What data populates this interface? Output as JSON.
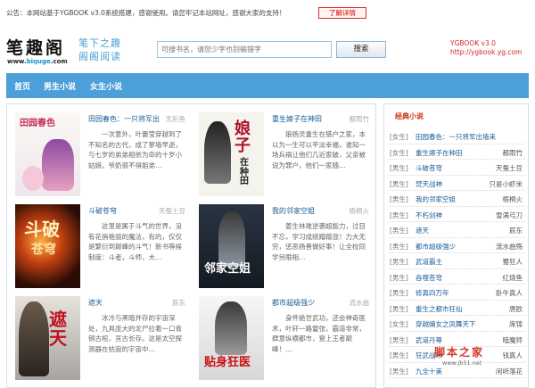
{
  "notice": {
    "text": "公告：本网站基于YGBOOK v3.0系统搭建，感谢使用。请您牢记本站网址，感谢大家的支持！",
    "button": "了解详情"
  },
  "header": {
    "logo_text": "笔趣阁",
    "logo_url_prefix": "www.",
    "logo_url_brand": "biquge",
    "logo_url_suffix": ".com",
    "slogan_line1": "笔下之趣",
    "slogan_line2": "阁阁阅读",
    "search_placeholder": "可搜书名，请您少字也别输错字",
    "search_button": "搜索",
    "site_name": "YGBOOK v3.0",
    "site_url": "http://ygbook.yg.com"
  },
  "nav": {
    "items": [
      "首页",
      "男生小说",
      "女生小说"
    ]
  },
  "books": [
    {
      "title": "田园春色：一只将军出",
      "author": "无彩鱼",
      "desc": "一次意外，叶蕾莹穿越到了不知名的古代，成了寥墙早逝，与七岁的弟弟相依为命的十岁小姑娘。爷奶很不得姐弟…",
      "cover_title": "田园春色一只将军出墙来",
      "cover_colors": [
        "#f4f0ea",
        "#d84b6a",
        "#6a3a8a"
      ]
    },
    {
      "title": "重生嫁子在神田",
      "author": "都雨竹",
      "desc": "狼扬灵重生在猎户之家，本以为一生可以平淡幸福，谁知一场兵祸让他们几近家破，父亲被说为罪户，他们一家随…",
      "cover_title": "娘子在种田",
      "cover_colors": [
        "#f3f1ec",
        "#b0102a",
        "#333333"
      ]
    },
    {
      "title": "斗破苍穹",
      "author": "天蚕土豆",
      "desc": "这里是属于斗气的世界，没有花俏艳丽的魔法，有的，仅仅是繁衍到巅峰的斗气！新书等候制度：斗者，斗师，大…",
      "cover_title": "斗破苍穹",
      "cover_colors": [
        "#3a1a10",
        "#e06a20",
        "#ffd070"
      ]
    },
    {
      "title": "我的邻家空姐",
      "author": "梧桐火",
      "desc": "姜生林难逆袭超能力，过目不忘，学习成绩蹭蹭涨！力大无穷，惩恶扬善做好事！让全校同学另眼相…",
      "cover_title": "我的邻家空姐",
      "cover_colors": [
        "#1a2230",
        "#ffffff",
        "#6a7a8a"
      ]
    },
    {
      "title": "遮天",
      "author": "辰东",
      "desc": "冰冷与黑暗并存的宇宙深处，九具庞大的龙尸拉着一口青铜古棺，亘古长存。这是太空探测器在枯寂的宇宙中…",
      "cover_title": "遮天",
      "cover_colors": [
        "#e8e4de",
        "#c01020",
        "#555555"
      ]
    },
    {
      "title": "都市超级强少",
      "author": "流水曲",
      "desc": "身怀绝世武功，还会神奇医术，叶轩一路雷张，霸道非常，肆意纵横都市，登上王者巅峰！…",
      "cover_title": "贴身狂医",
      "cover_colors": [
        "#f2f2f2",
        "#c81010",
        "#444444"
      ]
    }
  ],
  "sidebar": {
    "title": "经典小说",
    "items": [
      {
        "cat": "[女生]",
        "name": "田园春色：一只将军出墙来",
        "author": ""
      },
      {
        "cat": "[女生]",
        "name": "重生嫁子在种田",
        "author": "都雨竹"
      },
      {
        "cat": "[男生]",
        "name": "斗破苍穹",
        "author": "天蚕土豆"
      },
      {
        "cat": "[男生]",
        "name": "焚天战神",
        "author": "只是小虾米"
      },
      {
        "cat": "[男生]",
        "name": "我的邻家空姐",
        "author": "梧桐火"
      },
      {
        "cat": "[男生]",
        "name": "不朽剑神",
        "author": "雪满弓刀"
      },
      {
        "cat": "[男生]",
        "name": "遮天",
        "author": "辰东"
      },
      {
        "cat": "[男生]",
        "name": "都市超级强少",
        "author": "流水曲殇"
      },
      {
        "cat": "[男生]",
        "name": "武道霸主",
        "author": "蜀狂人"
      },
      {
        "cat": "[男生]",
        "name": "吞噬苍穹",
        "author": "红烧鱼"
      },
      {
        "cat": "[男生]",
        "name": "修真四万年",
        "author": "卧牛真人"
      },
      {
        "cat": "[男生]",
        "name": "重生之都市狂仙",
        "author": "唐欧"
      },
      {
        "cat": "[女生]",
        "name": "穿越嫡女之凤舞天下",
        "author": "席锦"
      },
      {
        "cat": "[男生]",
        "name": "武道丹尊",
        "author": "暗魔师"
      },
      {
        "cat": "[男生]",
        "name": "狂武战帝",
        "author": "钱真人"
      },
      {
        "cat": "[男生]",
        "name": "九全十美",
        "author": "闲听落花"
      }
    ]
  },
  "watermark": {
    "text": "脚本之家",
    "url": "www.jb51.net"
  }
}
